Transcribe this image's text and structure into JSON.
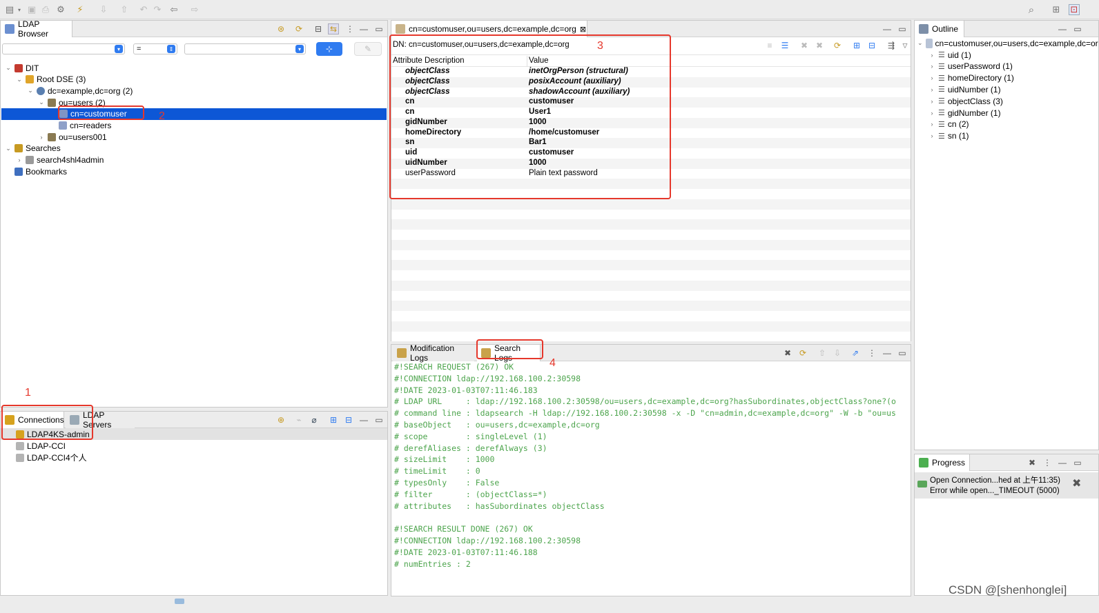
{
  "browser": {
    "title": "LDAP Browser",
    "filter_op": "=",
    "tree": [
      {
        "label": "DIT",
        "level": 0,
        "twisty": "down",
        "icon": "dit-icon"
      },
      {
        "label": "Root DSE (3)",
        "level": 1,
        "twisty": "down",
        "icon": "root-dse-icon"
      },
      {
        "label": "dc=example,dc=org (2)",
        "level": 2,
        "twisty": "down",
        "icon": "globe-icon"
      },
      {
        "label": "ou=users (2)",
        "level": 3,
        "twisty": "down",
        "icon": "org-unit-icon"
      },
      {
        "label": "cn=customuser",
        "level": 4,
        "twisty": "",
        "icon": "person-icon",
        "selected": true
      },
      {
        "label": "cn=readers",
        "level": 4,
        "twisty": "",
        "icon": "group-icon"
      },
      {
        "label": "ou=users001",
        "level": 3,
        "twisty": "right",
        "icon": "org-unit-icon"
      },
      {
        "label": "Searches",
        "level": 0,
        "twisty": "down",
        "icon": "searches-icon"
      },
      {
        "label": "search4shl4admin",
        "level": 1,
        "twisty": "right",
        "icon": "search-icon"
      },
      {
        "label": "Bookmarks",
        "level": 0,
        "twisty": "",
        "icon": "bookmarks-icon"
      }
    ]
  },
  "connections": {
    "tab1": "Connections",
    "tab2": "LDAP Servers",
    "items": [
      "LDAP4KS-admin",
      "LDAP-CCI",
      "LDAP-CCI4个人"
    ]
  },
  "editor": {
    "tab_title": "cn=customuser,ou=users,dc=example,dc=org",
    "dn": "DN: cn=customuser,ou=users,dc=example,dc=org",
    "col_attr": "Attribute Description",
    "col_value": "Value",
    "rows": [
      {
        "k": "objectClass",
        "v": "inetOrgPerson (structural)",
        "style": "bi"
      },
      {
        "k": "objectClass",
        "v": "posixAccount (auxiliary)",
        "style": "bi"
      },
      {
        "k": "objectClass",
        "v": "shadowAccount (auxiliary)",
        "style": "bi"
      },
      {
        "k": "cn",
        "v": "customuser",
        "style": "b"
      },
      {
        "k": "cn",
        "v": "User1",
        "style": "b"
      },
      {
        "k": "gidNumber",
        "v": "1000",
        "style": "b"
      },
      {
        "k": "homeDirectory",
        "v": "/home/customuser",
        "style": "b"
      },
      {
        "k": "sn",
        "v": "Bar1",
        "style": "b"
      },
      {
        "k": "uid",
        "v": "customuser",
        "style": "b"
      },
      {
        "k": "uidNumber",
        "v": "1000",
        "style": "b"
      },
      {
        "k": "userPassword",
        "v": "Plain text password",
        "style": "n"
      }
    ]
  },
  "logs": {
    "tab1": "Modification Logs",
    "tab2": "Search Logs",
    "lines": [
      "#!SEARCH REQUEST (267) OK",
      "#!CONNECTION ldap://192.168.100.2:30598",
      "#!DATE 2023-01-03T07:11:46.183",
      "# LDAP URL     : ldap://192.168.100.2:30598/ou=users,dc=example,dc=org?hasSubordinates,objectClass?one?(o",
      "# command line : ldapsearch -H ldap://192.168.100.2:30598 -x -D \"cn=admin,dc=example,dc=org\" -W -b \"ou=us",
      "# baseObject   : ou=users,dc=example,dc=org",
      "# scope        : singleLevel (1)",
      "# derefAliases : derefAlways (3)",
      "# sizeLimit    : 1000",
      "# timeLimit    : 0",
      "# typesOnly    : False",
      "# filter       : (objectClass=*)",
      "# attributes   : hasSubordinates objectClass",
      "",
      "#!SEARCH RESULT DONE (267) OK",
      "#!CONNECTION ldap://192.168.100.2:30598",
      "#!DATE 2023-01-03T07:11:46.188",
      "# numEntries : 2"
    ]
  },
  "outline": {
    "title": "Outline",
    "root": "cn=customuser,ou=users,dc=example,dc=org",
    "items": [
      "uid (1)",
      "userPassword (1)",
      "homeDirectory (1)",
      "uidNumber (1)",
      "objectClass (3)",
      "gidNumber (1)",
      "cn (2)",
      "sn (1)"
    ]
  },
  "progress": {
    "title": "Progress",
    "line1": "Open Connection...hed at 上午11:35)",
    "line2": "Error while open..._TIMEOUT (5000)"
  },
  "annotations": {
    "n1": "1",
    "n2": "2",
    "n3": "3",
    "n4": "4"
  },
  "watermark": "CSDN @[shenhonglei]"
}
